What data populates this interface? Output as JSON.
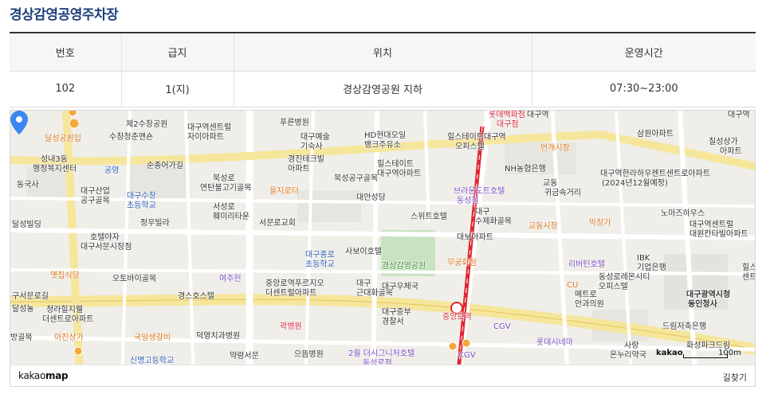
{
  "page": {
    "title": "경상감영공영주차장"
  },
  "table": {
    "headers": [
      "번호",
      "급지",
      "위치",
      "운영시간"
    ],
    "row": [
      "102",
      "1(지)",
      "경상감영공원 지하",
      "07:30~23:00"
    ]
  },
  "map": {
    "labels": [
      {
        "text": "달성공원입",
        "c": "orange"
      },
      {
        "text": "제2수창공원",
        "c": ""
      },
      {
        "text": "수창청춘맨숀",
        "c": ""
      },
      {
        "text": "성내3동",
        "c": ""
      },
      {
        "text": "행정복지센터",
        "c": ""
      },
      {
        "text": "공영",
        "c": "blue"
      },
      {
        "text": "순종어가길",
        "c": ""
      },
      {
        "text": "동국사",
        "c": ""
      },
      {
        "text": "대구산업",
        "c": ""
      },
      {
        "text": "공구골목",
        "c": ""
      },
      {
        "text": "대구수창",
        "c": "blue"
      },
      {
        "text": "초등학교",
        "c": "blue"
      },
      {
        "text": "정우빌라",
        "c": ""
      },
      {
        "text": "달성빌딩",
        "c": ""
      },
      {
        "text": "호텔야자",
        "c": ""
      },
      {
        "text": "대구서문시장점",
        "c": ""
      },
      {
        "text": "옛집식당",
        "c": "orange"
      },
      {
        "text": "오토바이골목",
        "c": ""
      },
      {
        "text": "여주헌",
        "c": "purple"
      },
      {
        "text": "구서문로길",
        "c": ""
      },
      {
        "text": "청라힐지웰",
        "c": ""
      },
      {
        "text": "더센트로아파트",
        "c": ""
      },
      {
        "text": "경스호스텔",
        "c": ""
      },
      {
        "text": "아진상가",
        "c": "orange"
      },
      {
        "text": "국일생갈비",
        "c": "orange"
      },
      {
        "text": "덕영치과병원",
        "c": ""
      },
      {
        "text": "신명고등학교",
        "c": "blue"
      },
      {
        "text": "약령서문",
        "c": ""
      },
      {
        "text": "방골목",
        "c": ""
      },
      {
        "text": "대구역센트럴",
        "c": ""
      },
      {
        "text": "자이아파트",
        "c": ""
      },
      {
        "text": "푸른병원",
        "c": ""
      },
      {
        "text": "대구예술",
        "c": ""
      },
      {
        "text": "기숙사",
        "c": ""
      },
      {
        "text": "경진테크빌",
        "c": ""
      },
      {
        "text": "아파트",
        "c": ""
      },
      {
        "text": "북성로",
        "c": ""
      },
      {
        "text": "연탄불고기골목",
        "c": ""
      },
      {
        "text": "을지로터",
        "c": "orange"
      },
      {
        "text": "서성로",
        "c": ""
      },
      {
        "text": "훼미리타운",
        "c": ""
      },
      {
        "text": "서문로교회",
        "c": ""
      },
      {
        "text": "대구종로",
        "c": "blue"
      },
      {
        "text": "초등학교",
        "c": "blue"
      },
      {
        "text": "중앙로역푸르지오",
        "c": ""
      },
      {
        "text": "더센트럴아파트",
        "c": ""
      },
      {
        "text": "곽병원",
        "c": "red"
      },
      {
        "text": "으뜸병원",
        "c": ""
      },
      {
        "text": "HD현대오일",
        "c": ""
      },
      {
        "text": "뱅크주유소",
        "c": ""
      },
      {
        "text": "북성공구골목",
        "c": ""
      },
      {
        "text": "대안성당",
        "c": ""
      },
      {
        "text": "사보이호텔",
        "c": ""
      },
      {
        "text": "경상감영공원",
        "c": "green"
      },
      {
        "text": "대구",
        "c": ""
      },
      {
        "text": "근대화골목",
        "c": ""
      },
      {
        "text": "대구우체국",
        "c": ""
      },
      {
        "text": "대구중부",
        "c": ""
      },
      {
        "text": "경찰서",
        "c": ""
      },
      {
        "text": "2월 더시그니처호텔",
        "c": "purple"
      },
      {
        "text": "동성로점",
        "c": "purple"
      },
      {
        "text": "힐스테이트",
        "c": ""
      },
      {
        "text": "대구역아파트",
        "c": ""
      },
      {
        "text": "브라운도트호텔",
        "c": "purple"
      },
      {
        "text": "동성점",
        "c": "purple"
      },
      {
        "text": "스위트호텔",
        "c": ""
      },
      {
        "text": "힐스테이트대구역",
        "c": ""
      },
      {
        "text": "오피스텔",
        "c": ""
      },
      {
        "text": "롯데백화점",
        "c": "red"
      },
      {
        "text": "대구점",
        "c": "red"
      },
      {
        "text": "NH농협은행",
        "c": ""
      },
      {
        "text": "대구",
        "c": ""
      },
      {
        "text": "수제화골목",
        "c": ""
      },
      {
        "text": "대보아파트",
        "c": ""
      },
      {
        "text": "무궁화점",
        "c": "orange"
      },
      {
        "text": "중앙로역",
        "c": "red"
      },
      {
        "text": "CGV",
        "c": "purple"
      },
      {
        "text": "CGV",
        "c": "purple"
      },
      {
        "text": "대구역",
        "c": ""
      },
      {
        "text": "번개시장",
        "c": "orange"
      },
      {
        "text": "교동",
        "c": ""
      },
      {
        "text": "귀금속거리",
        "c": ""
      },
      {
        "text": "교동시장",
        "c": "orange"
      },
      {
        "text": "리버틴호텔",
        "c": "purple"
      },
      {
        "text": "동성로레몬시티",
        "c": ""
      },
      {
        "text": "오피스텔",
        "c": ""
      },
      {
        "text": "메트로",
        "c": ""
      },
      {
        "text": "안과의원",
        "c": ""
      },
      {
        "text": "롯데시네마",
        "c": "purple"
      },
      {
        "text": "사랑",
        "c": ""
      },
      {
        "text": "온누리약국",
        "c": ""
      },
      {
        "text": "CU",
        "c": "orange"
      },
      {
        "text": "삼원아파트",
        "c": ""
      },
      {
        "text": "칠성상가",
        "c": ""
      },
      {
        "text": "아파트",
        "c": ""
      },
      {
        "text": "대구역한라하우젠트센트로아파트",
        "c": ""
      },
      {
        "text": "(2024년12월예정)",
        "c": ""
      },
      {
        "text": "막창가",
        "c": "orange"
      },
      {
        "text": "노마즈하우스",
        "c": ""
      },
      {
        "text": "대구역센트럴",
        "c": ""
      },
      {
        "text": "대원칸타빌아파트",
        "c": ""
      },
      {
        "text": "IBK",
        "c": ""
      },
      {
        "text": "기업은행",
        "c": ""
      },
      {
        "text": "힐스",
        "c": ""
      },
      {
        "text": "센트",
        "c": ""
      },
      {
        "text": "대구광역시청",
        "c": "bold"
      },
      {
        "text": "동인청사",
        "c": "bold"
      },
      {
        "text": "드림저축은행",
        "c": ""
      },
      {
        "text": "화성파크드림",
        "c": ""
      },
      {
        "text": "대구역",
        "c": ""
      },
      {
        "text": "달성농",
        "c": ""
      },
      {
        "text": "성내1동",
        "c": ""
      }
    ],
    "scale_logo": "kakao",
    "scale_text": "100m",
    "brand_prefix": "kakao",
    "brand_suffix": "map",
    "directions": "길찾기"
  }
}
